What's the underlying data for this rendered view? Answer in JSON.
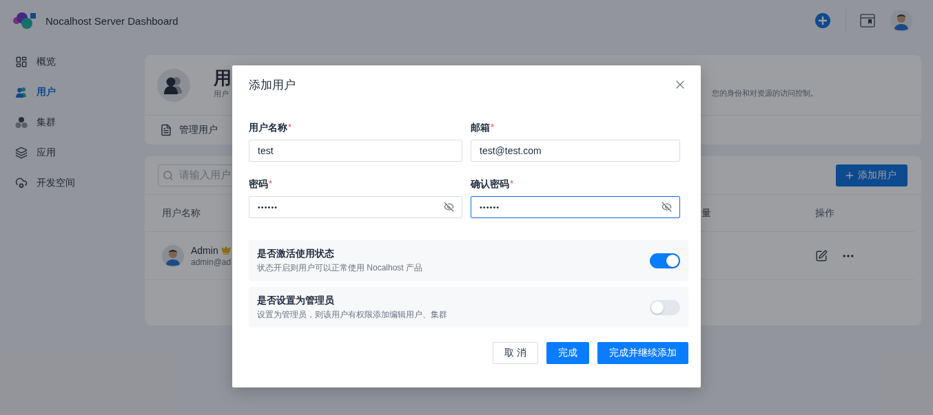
{
  "app": {
    "title": "Nocalhost Server Dashboard"
  },
  "sidebar": {
    "items": [
      {
        "label": "概览",
        "kind": "overview",
        "selected": false
      },
      {
        "label": "用户",
        "kind": "users",
        "selected": true
      },
      {
        "label": "集群",
        "kind": "clusters",
        "selected": false
      },
      {
        "label": "应用",
        "kind": "apps",
        "selected": false
      },
      {
        "label": "开发空间",
        "kind": "spaces",
        "selected": false
      }
    ]
  },
  "header_card": {
    "title": "用",
    "subtitle": "用户",
    "description": "您的身份和对资源的访问控制。",
    "tab": "管理用户"
  },
  "users_table": {
    "search": {
      "placeholder": "请输入用户"
    },
    "add_button": "添加用户",
    "columns": [
      "用户名称",
      "量",
      "操作"
    ],
    "rows": [
      {
        "name": "Admin",
        "email": "admin@ad"
      }
    ]
  },
  "dialog": {
    "title": "添加用户",
    "fields": [
      {
        "label": "用户名称",
        "required_mark": "*",
        "value": "test",
        "kind": "text",
        "focused": false
      },
      {
        "label": "邮箱",
        "required_mark": "*",
        "value": "test@test.com",
        "kind": "text",
        "focused": false
      },
      {
        "label": "密码",
        "required_mark": "*",
        "value": "••••••",
        "kind": "password",
        "focused": false
      },
      {
        "label": "确认密码",
        "required_mark": "*",
        "value": "••••••",
        "kind": "password",
        "focused": true
      }
    ],
    "toggles": [
      {
        "title": "是否激活使用状态",
        "description": "状态开启则用户可以正常使用 Nocalhost 产品",
        "on": true
      },
      {
        "title": "是否设置为管理员",
        "description": "设置为管理员，则该用户有权限添加编辑用户、集群",
        "on": false
      }
    ],
    "buttons": [
      {
        "label": "取 消",
        "kind": "default"
      },
      {
        "label": "完成",
        "kind": "primary"
      },
      {
        "label": "完成并继续添加",
        "kind": "primary"
      }
    ]
  }
}
